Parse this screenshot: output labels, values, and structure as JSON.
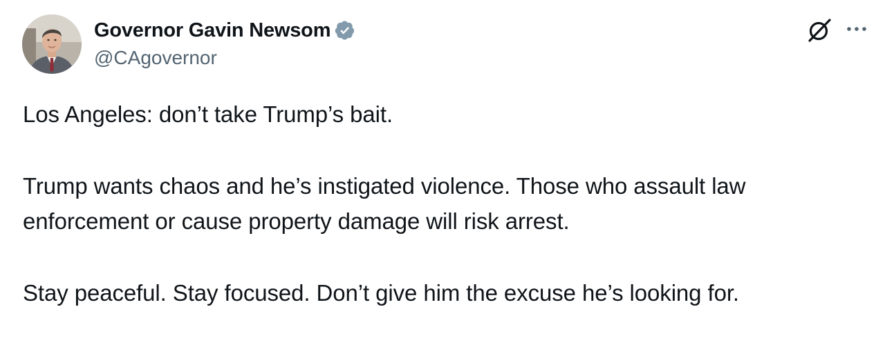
{
  "author": {
    "display_name": "Governor Gavin Newsom",
    "handle": "@CAgovernor",
    "verified_badge": "verified-badge-icon"
  },
  "header_actions": {
    "grok_icon": "grok-icon",
    "more_icon": "more-icon"
  },
  "tweet": {
    "paragraphs": [
      "Los Angeles: don’t take Trump’s bait.",
      "Trump wants chaos and he’s instigated violence. Those who assault law enforcement or cause property damage will risk arrest.",
      "Stay peaceful. Stay focused. Don’t give him the excuse he’s looking for."
    ]
  },
  "colors": {
    "text": "#0f1419",
    "secondary_text": "#536471",
    "verified_badge": "#829aab"
  }
}
